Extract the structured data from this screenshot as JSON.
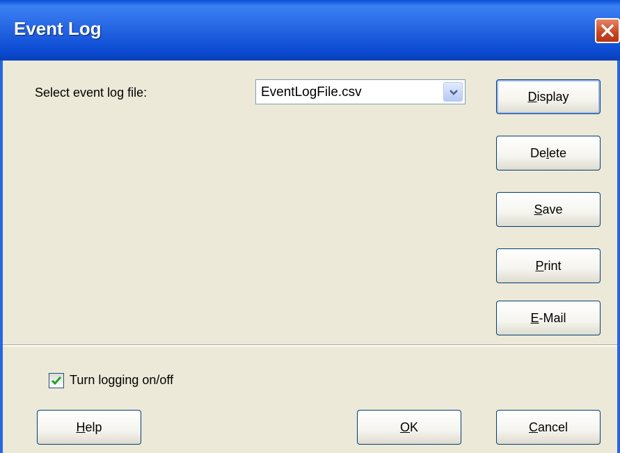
{
  "window": {
    "title": "Event Log"
  },
  "log_file": {
    "label": "Select event log file:",
    "selected_value": "EventLogFile.csv"
  },
  "side_buttons": [
    {
      "label": "Display",
      "mnemonic": "D"
    },
    {
      "label": "Delete",
      "mnemonic": "l"
    },
    {
      "label": "Save",
      "mnemonic": "S"
    },
    {
      "label": "Print",
      "mnemonic": "P"
    },
    {
      "label": "E-Mail",
      "mnemonic": "E"
    }
  ],
  "logging": {
    "label": "Turn logging on/off",
    "checked": true
  },
  "footer_buttons": [
    {
      "label": "Help",
      "mnemonic": "H"
    },
    {
      "label": "OK",
      "mnemonic": "O"
    },
    {
      "label": "Cancel",
      "mnemonic": "C"
    }
  ],
  "colors": {
    "title_bar": "#2766e3",
    "close_button": "#c8451f",
    "dialog_bg": "#ece9d8",
    "check_mark": "#21a121"
  },
  "icons": {
    "close": "close-icon",
    "dropdown": "chevron-down-icon",
    "check": "check-icon"
  }
}
